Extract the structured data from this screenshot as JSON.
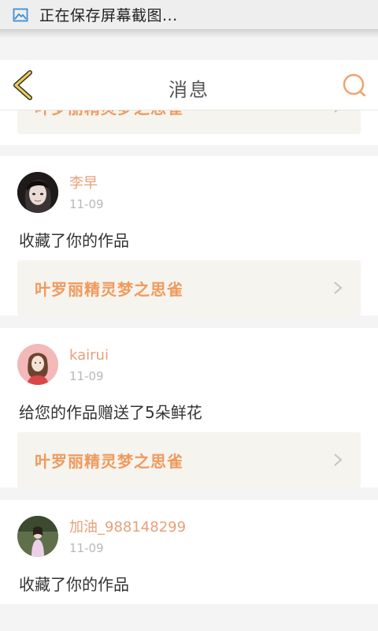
{
  "notification": {
    "text": "正在保存屏幕截图...",
    "icon": "screenshot-icon"
  },
  "header": {
    "title": "消息",
    "back_icon": "chevron-left-icon",
    "search_icon": "search-icon",
    "accent": "#f1b34f"
  },
  "colors": {
    "username": "#e8a07a",
    "work_title": "#ef9a5e",
    "work_bg": "#f6f4ee"
  },
  "items": [
    {
      "work_title": "叶罗丽精灵梦之思雀"
    },
    {
      "username": "李早",
      "date": "11-09",
      "action": "收藏了你的作品",
      "work_title": "叶罗丽精灵梦之思雀"
    },
    {
      "username": "kairui",
      "date": "11-09",
      "action": "给您的作品赠送了5朵鲜花",
      "work_title": "叶罗丽精灵梦之思雀"
    },
    {
      "username": "加油_988148299",
      "date": "11-09",
      "action": "收藏了你的作品"
    }
  ]
}
